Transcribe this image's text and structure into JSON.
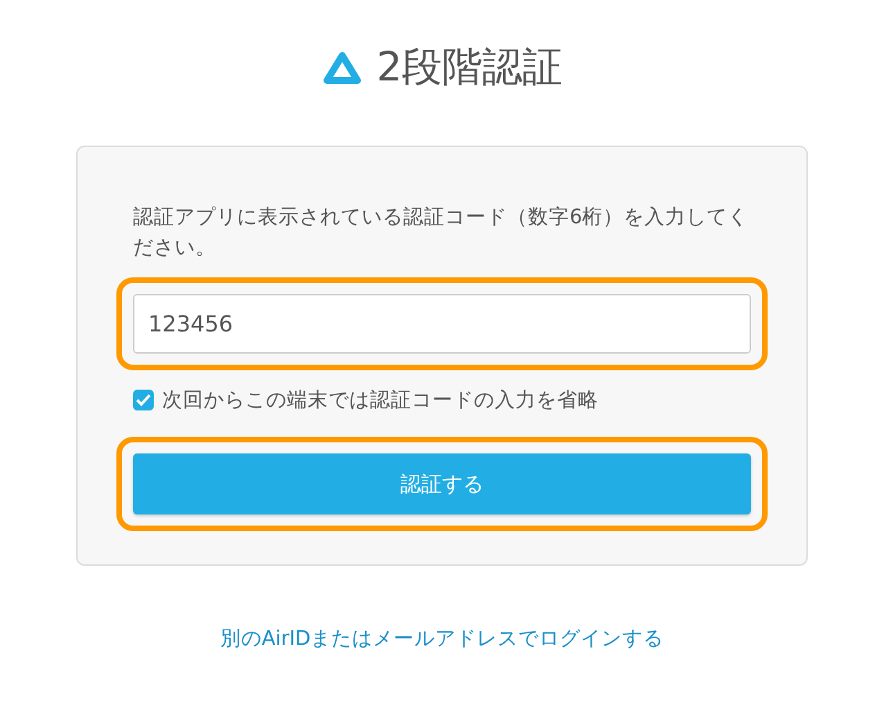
{
  "title": "2段階認証",
  "instruction": "認証アプリに表示されている認証コード（数字6桁）を入力してください。",
  "code_field": {
    "value": "123456",
    "highlighted": true
  },
  "remember": {
    "label": "次回からこの端末では認証コードの入力を省略",
    "checked": true
  },
  "submit": {
    "label": "認証する",
    "highlighted": true
  },
  "alt_link": "別のAirIDまたはメールアドレスでログインする"
}
